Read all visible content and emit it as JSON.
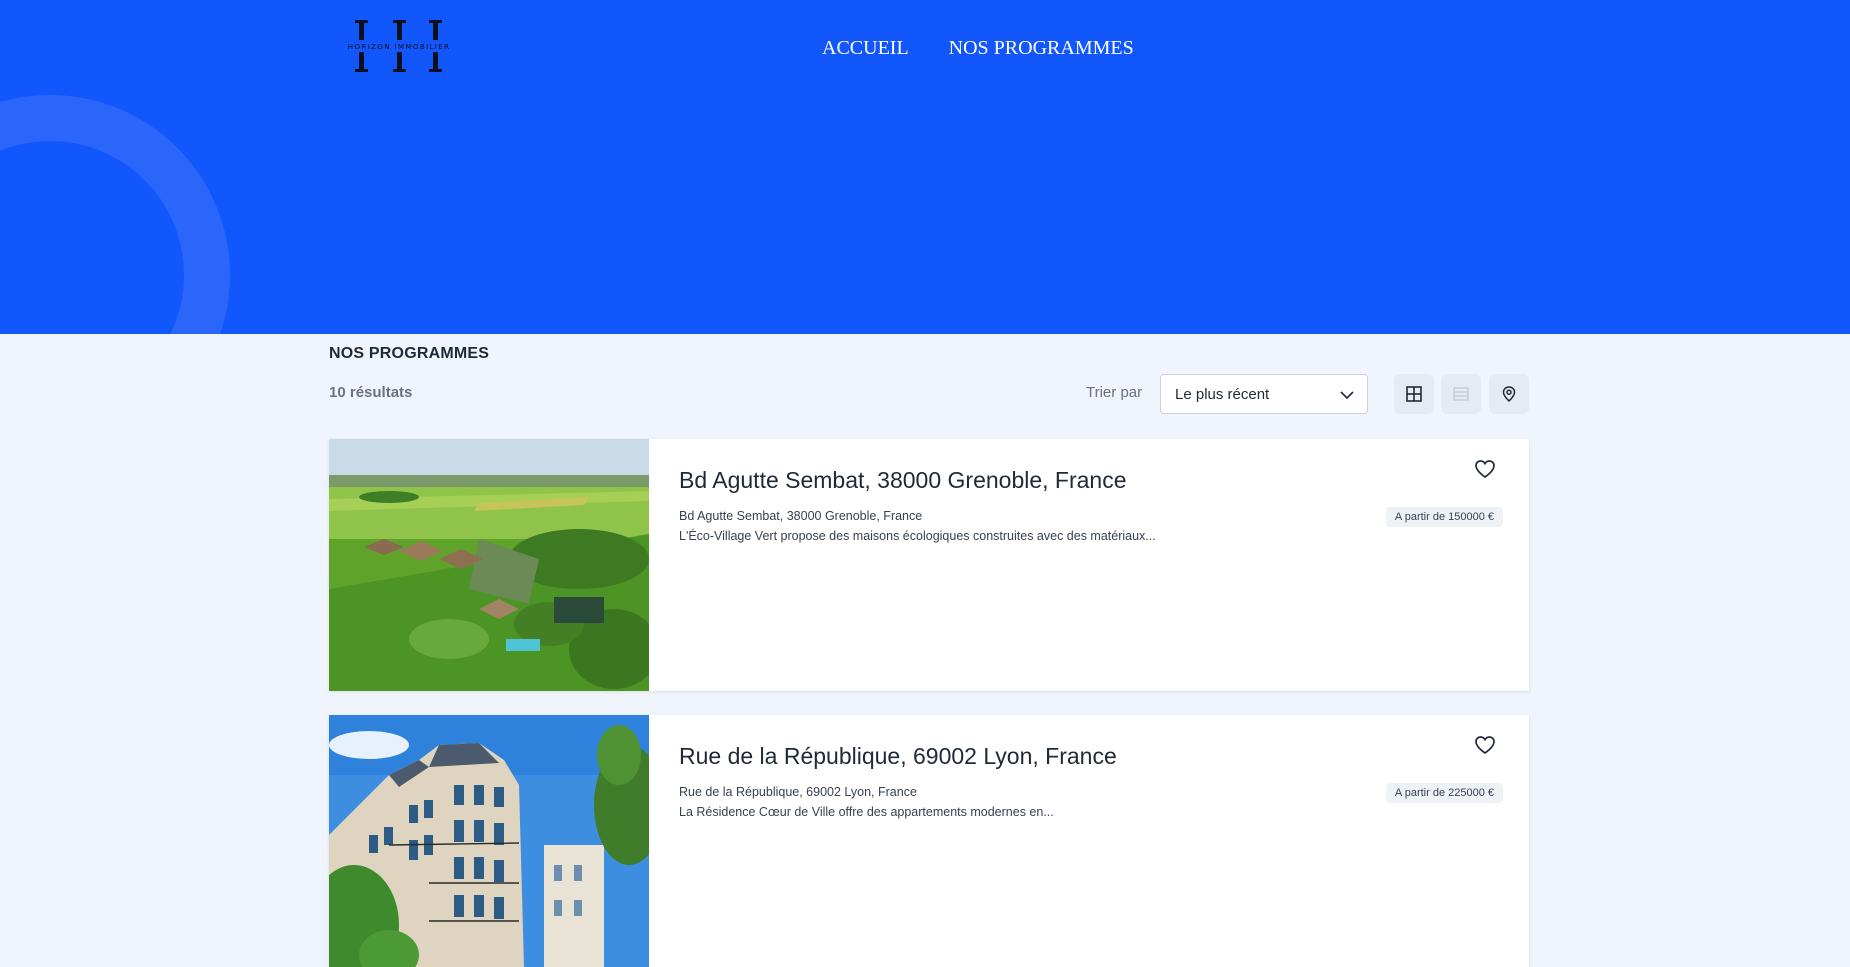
{
  "brand": {
    "logo_letters": "HI",
    "logo_text": "HORIZON IMMOBILIER"
  },
  "nav": {
    "items": [
      {
        "label": "ACCUEIL"
      },
      {
        "label": "NOS PROGRAMMES"
      }
    ]
  },
  "listing": {
    "section_title": "NOS PROGRAMMES",
    "results_count": "10 résultats",
    "sort_label": "Trier par",
    "sort_value": "Le plus récent",
    "view_modes": [
      "grid-view-icon",
      "list-view-icon",
      "map-view-icon"
    ]
  },
  "programs": [
    {
      "title": "Bd Agutte Sembat, 38000 Grenoble, France",
      "address": "Bd Agutte Sembat, 38000 Grenoble, France",
      "description": "L'Éco-Village Vert propose des maisons écologiques construites avec des matériaux...",
      "price": "A partir de 150000 €",
      "image": "aerial-countryside-village-photo"
    },
    {
      "title": "Rue de la République, 69002 Lyon, France",
      "address": "Rue de la République, 69002 Lyon, France",
      "description": "La Résidence Cœur de Ville offre des appartements modernes en...",
      "price": "A partir de 225000 €",
      "image": "haussmann-building-photo"
    }
  ],
  "colors": {
    "hero_blue": "#1257fb",
    "page_bg": "#f0f5fd",
    "card_bg": "#ffffff"
  }
}
